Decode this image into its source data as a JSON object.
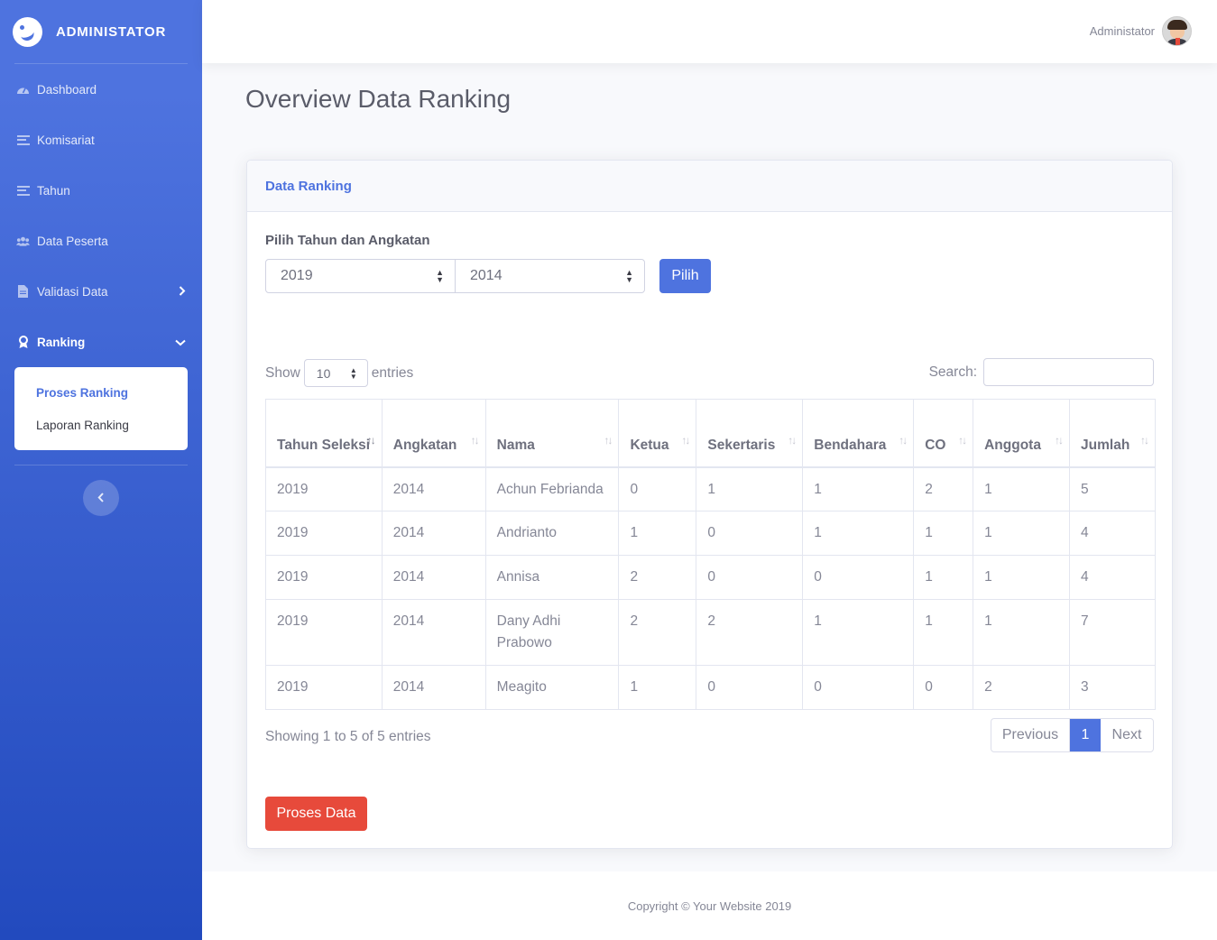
{
  "brand": {
    "title": "ADMINISTATOR"
  },
  "sidebar": {
    "items": [
      {
        "label": "Dashboard",
        "icon": "tachometer-icon"
      },
      {
        "label": "Komisariat",
        "icon": "bars-icon"
      },
      {
        "label": "Tahun",
        "icon": "bars-icon"
      },
      {
        "label": "Data Peserta",
        "icon": "users-icon"
      },
      {
        "label": "Validasi Data",
        "icon": "file-icon"
      },
      {
        "label": "Ranking",
        "icon": "award-icon"
      }
    ],
    "submenu": [
      {
        "label": "Proses Ranking"
      },
      {
        "label": "Laporan Ranking"
      }
    ]
  },
  "topbar": {
    "user_name": "Administator"
  },
  "page": {
    "title": "Overview Data Ranking"
  },
  "card": {
    "header": "Data Ranking",
    "select_label": "Pilih Tahun dan Angkatan",
    "tahun_value": "2019",
    "angkatan_value": "2014",
    "pilih_button": "Pilih",
    "show_label": "Show",
    "entries_value": "10",
    "entries_label": "entries",
    "search_label": "Search:",
    "info": "Showing 1 to 5 of 5 entries",
    "pager": {
      "previous": "Previous",
      "current": "1",
      "next": "Next"
    },
    "proses_button": "Proses Data"
  },
  "table": {
    "headers": [
      "Tahun Seleksi",
      "Angkatan",
      "Nama",
      "Ketua",
      "Sekertaris",
      "Bendahara",
      "CO",
      "Anggota",
      "Jumlah"
    ],
    "rows": [
      [
        "2019",
        "2014",
        "Achun Febrianda",
        "0",
        "1",
        "1",
        "2",
        "1",
        "5"
      ],
      [
        "2019",
        "2014",
        "Andrianto",
        "1",
        "0",
        "1",
        "1",
        "1",
        "4"
      ],
      [
        "2019",
        "2014",
        "Annisa",
        "2",
        "0",
        "0",
        "1",
        "1",
        "4"
      ],
      [
        "2019",
        "2014",
        "Dany Adhi Prabowo",
        "2",
        "2",
        "1",
        "1",
        "1",
        "7"
      ],
      [
        "2019",
        "2014",
        "Meagito",
        "1",
        "0",
        "0",
        "0",
        "2",
        "3"
      ]
    ]
  },
  "footer": {
    "text": "Copyright © Your Website 2019"
  },
  "colors": {
    "primary": "#4e73df",
    "danger": "#e74a3b",
    "sidebar_end": "#224abe"
  }
}
